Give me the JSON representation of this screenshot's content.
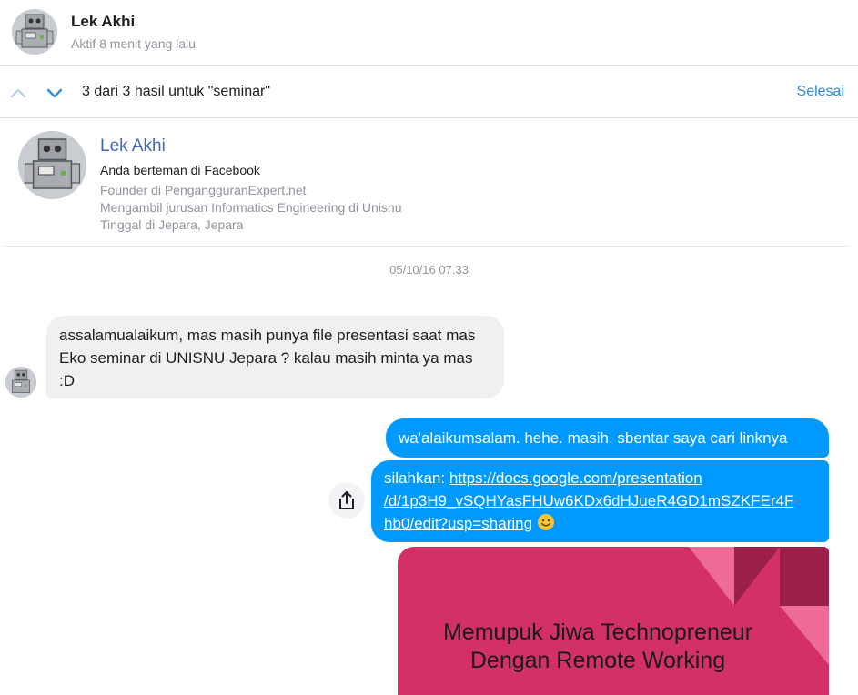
{
  "header": {
    "name": "Lek Akhi",
    "status": "Aktif 8 menit yang lalu"
  },
  "search": {
    "result_text": "3 dari 3 hasil untuk \"seminar\"",
    "done_label": "Selesai",
    "up_icon": "chevron-up-icon",
    "down_icon": "chevron-down-icon"
  },
  "profile": {
    "name": "Lek Akhi",
    "friends": "Anda berteman di Facebook",
    "info": [
      "Founder di PengangguranExpert.net",
      "Mengambil jurusan Informatics Engineering di Unisnu",
      "Tinggal di Jepara, Jepara"
    ]
  },
  "conversation": {
    "timestamp": "05/10/16 07.33",
    "incoming": {
      "text": "assalamualaikum, mas masih punya file presentasi saat mas Eko seminar di UNISNU Jepara ? kalau masih minta ya mas :D"
    },
    "outgoing": [
      {
        "text": "wa'alaikumsalam. hehe. masih. sbentar saya cari linknya"
      },
      {
        "prefix": "silahkan: ",
        "link": "https://docs.google.com/presentation/d/1p3H9_vSQHYasFHUw6KDx6dHJueR4GD1mSZKFEr4Fhb0/edit?usp=sharing",
        "link_line1": "https://docs.google.com/presentation",
        "link_line2": "/d/1p3H9_vSQHYasFHUw6KDx6dHJueR4GD1mSZKFEr4F",
        "link_line3": "hb0/edit?usp=sharing",
        "emoji": "smile-emoji"
      }
    ],
    "share_icon": "share-icon",
    "preview": {
      "title_line1": "Memupuk Jiwa Technopreneur",
      "title_line2": "Dengan Remote Working"
    }
  },
  "colors": {
    "accent": "#2c89e0",
    "outgoing_bubble": "#0099ff",
    "incoming_bubble": "#f1f0f0",
    "slide_background": "#d33068",
    "slide_dark": "#9b1f4b",
    "slide_light": "#ee6b95",
    "profile_name": "#4267b2",
    "muted_text": "#90949c"
  }
}
